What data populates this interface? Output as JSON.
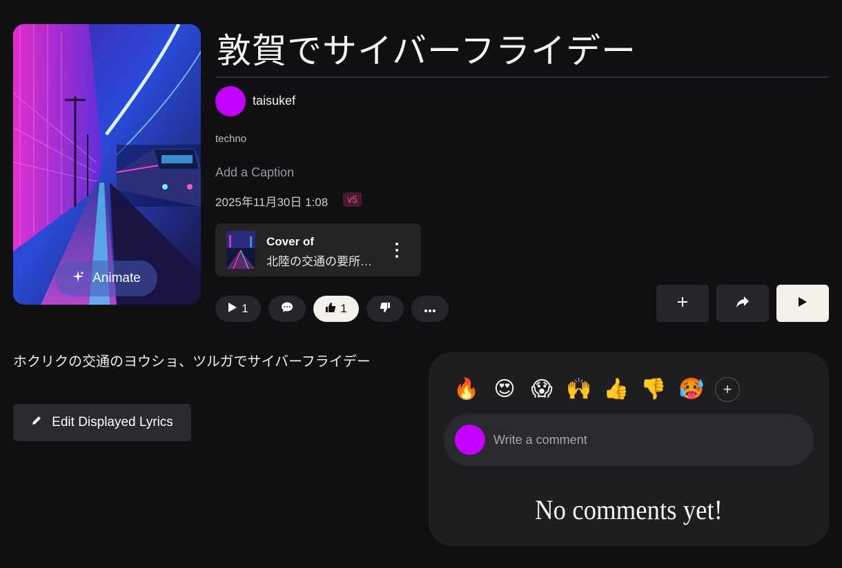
{
  "song": {
    "title": "敦賀でサイバーフライデー",
    "artist": "taisukef",
    "genre": "techno",
    "caption_placeholder": "Add a Caption",
    "datetime": "2025年11月30日 1:08",
    "version": "v5",
    "animate_label": "Animate"
  },
  "cover": {
    "label": "Cover of",
    "song": "北陸の交通の要所…"
  },
  "actions": {
    "play_count": "1",
    "like_count": "1"
  },
  "lyrics": {
    "text": "ホクリクの交通のヨウショ、ツルガでサイバーフライデー",
    "edit_label": "Edit Displayed Lyrics"
  },
  "comments": {
    "reactions": [
      "🔥",
      "😍",
      "😱",
      "🙌",
      "👍",
      "👎",
      "🥵"
    ],
    "placeholder": "Write a comment",
    "empty_text": "No comments yet!"
  },
  "colors": {
    "background": "#101012",
    "avatar": "#c300ff",
    "version_badge": "#e0508a",
    "active_pill": "#f4f1ea"
  }
}
